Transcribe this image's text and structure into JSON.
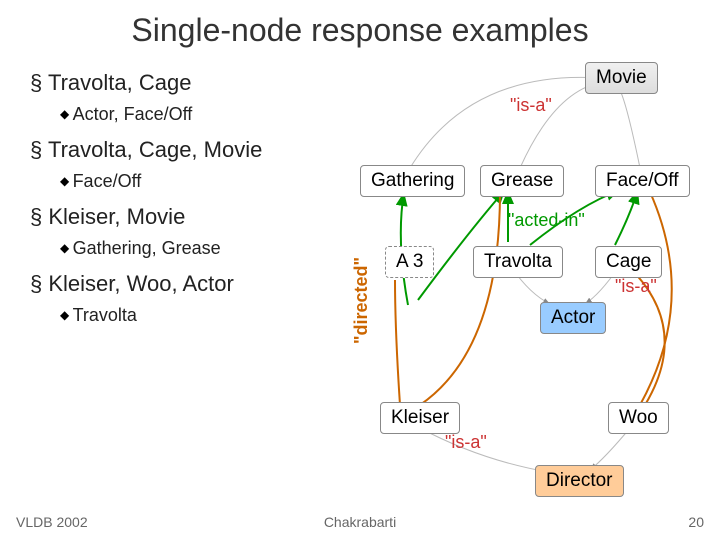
{
  "title": "Single-node response examples",
  "bullets": {
    "q1": "Travolta, Cage",
    "a1": "Actor, Face/Off",
    "q2": "Travolta, Cage, Movie",
    "a2": "Face/Off",
    "q3": "Kleiser, Movie",
    "a3": "Gathering, Grease",
    "q4": "Kleiser, Woo, Actor",
    "a4": "Travolta"
  },
  "nodes": {
    "movie": "Movie",
    "gathering": "Gathering",
    "grease": "Grease",
    "faceoff": "Face/Off",
    "a3": "A 3",
    "travolta": "Travolta",
    "cage": "Cage",
    "actor": "Actor",
    "kleiser": "Kleiser",
    "woo": "Woo",
    "director": "Director"
  },
  "edgeLabels": {
    "isa_top": "\"is-a\"",
    "directed": "\"directed\"",
    "actedin": "\"acted-in\"",
    "isa_mid": "\"is-a\"",
    "isa_bot": "\"is-a\""
  },
  "footer": {
    "left": "VLDB 2002",
    "center": "Chakrabarti",
    "right": "20"
  }
}
